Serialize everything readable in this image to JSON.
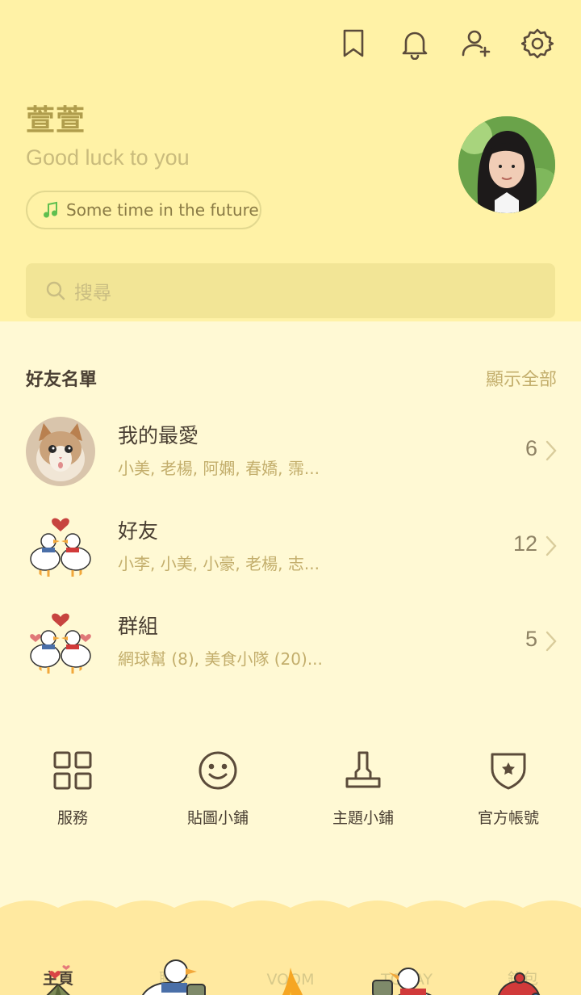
{
  "header": {
    "icons": [
      "bookmark-icon",
      "bell-icon",
      "add-friend-icon",
      "gear-icon"
    ],
    "name": "萱萱",
    "status": "Good luck to you",
    "music": "Some time in the future",
    "search_placeholder": "搜尋"
  },
  "friends": {
    "title": "好友名單",
    "show_all": "顯示全部",
    "rows": [
      {
        "title": "我的最愛",
        "sub": "小美, 老楊, 阿嫻, 春嬌, 霈...",
        "count": "6"
      },
      {
        "title": "好友",
        "sub": "小李, 小美, 小豪, 老楊, 志...",
        "count": "12"
      },
      {
        "title": "群組",
        "sub": "網球幫 (8), 美食小隊 (20)...",
        "count": "5"
      }
    ]
  },
  "services": [
    {
      "label": "服務",
      "icon": "grid-icon"
    },
    {
      "label": "貼圖小鋪",
      "icon": "smiley-icon"
    },
    {
      "label": "主題小鋪",
      "icon": "brush-icon"
    },
    {
      "label": "官方帳號",
      "icon": "shield-star-icon"
    }
  ],
  "nav": [
    {
      "label": "主頁",
      "icon": "tent-icon",
      "active": true
    },
    {
      "label": "聊天",
      "icon": "duck-chat-icon",
      "active": false
    },
    {
      "label": "VOOM",
      "icon": "campfire-icon",
      "active": false
    },
    {
      "label": "TODAY",
      "icon": "duck-today-icon",
      "active": false
    },
    {
      "label": "錢包",
      "icon": "beanie-icon",
      "active": false
    }
  ],
  "colors": {
    "header_bg": "#fff2a6",
    "body_bg": "#fff9d4",
    "accent_text": "#c3ae6c",
    "icon_stroke": "#5b4b3a"
  }
}
